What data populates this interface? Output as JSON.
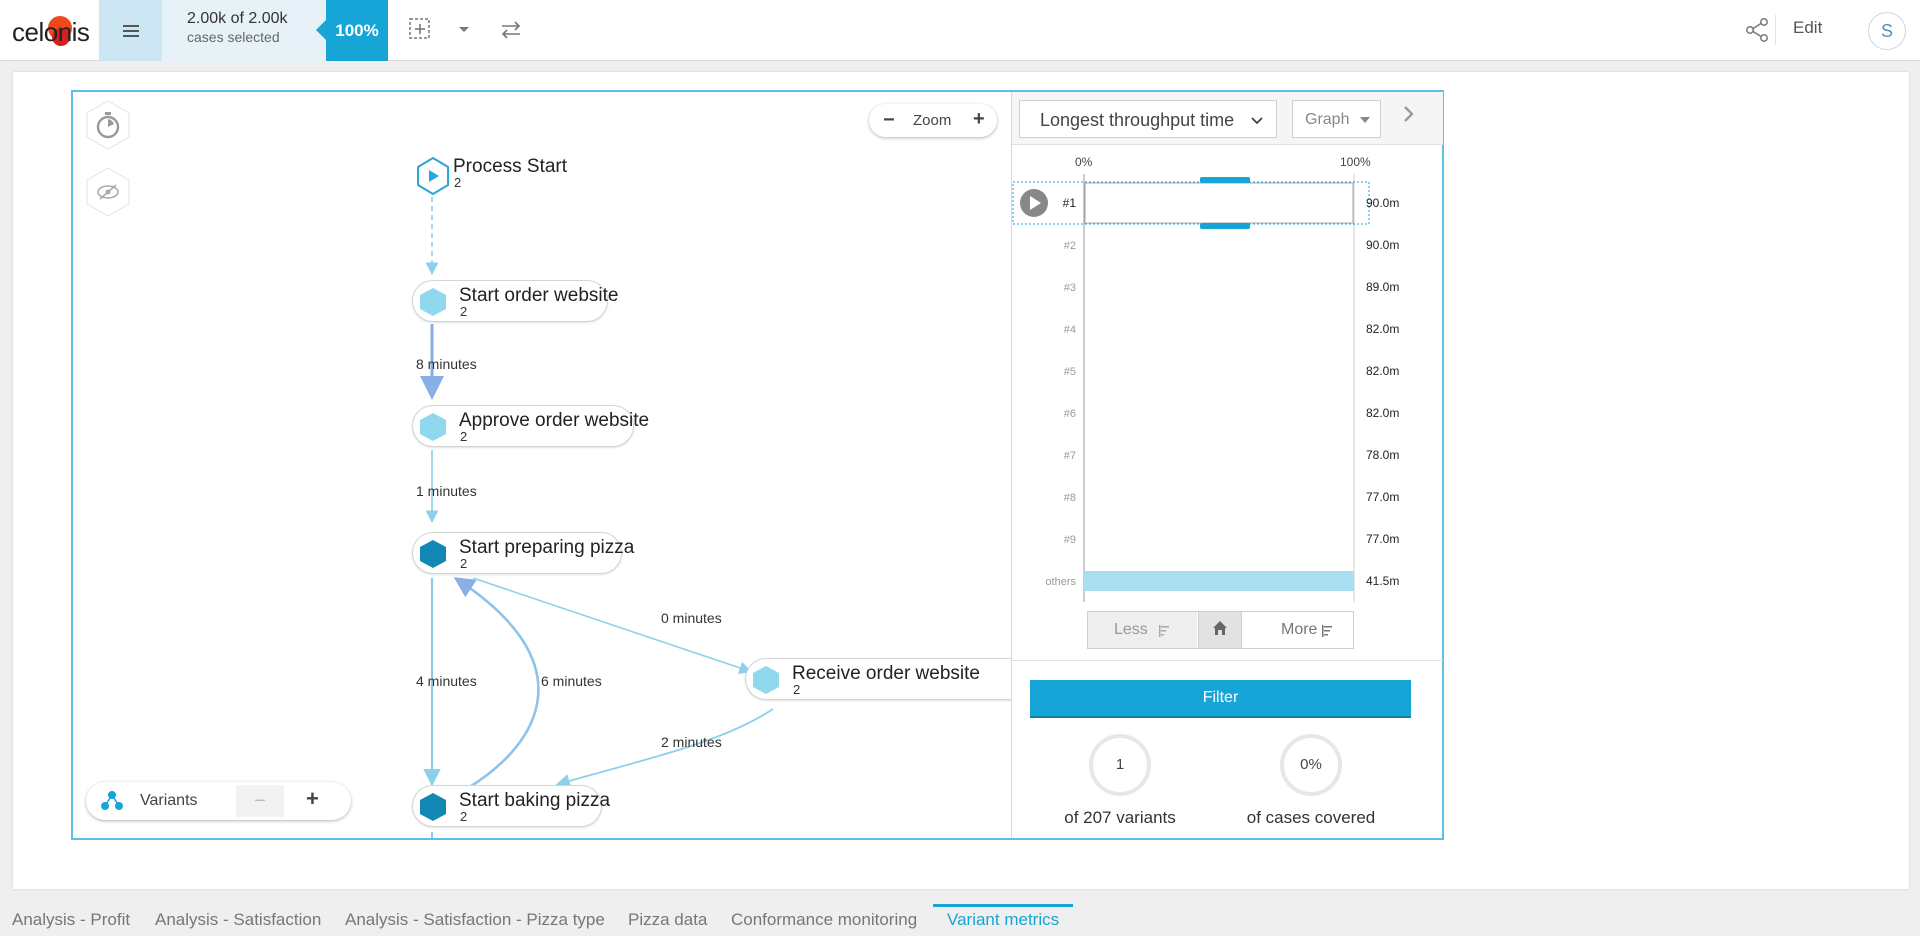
{
  "app": {
    "logo_text": "celonis"
  },
  "topbar": {
    "cases_count": "2.00k of 2.00k",
    "cases_label": "cases selected",
    "cases_pct": "100%",
    "edit_label": "Edit",
    "avatar_initial": "S"
  },
  "canvas": {
    "zoom_label": "Zoom",
    "variants_label": "Variants",
    "zoom_minus": "−",
    "zoom_plus": "+",
    "variants_minus": "−",
    "variants_plus": "+"
  },
  "nodes": [
    {
      "name": "Process Start",
      "count": "2"
    },
    {
      "name": "Start order website",
      "count": "2"
    },
    {
      "name": "Approve order website",
      "count": "2"
    },
    {
      "name": "Start preparing pizza",
      "count": "2"
    },
    {
      "name": "Receive order website",
      "count": "2"
    },
    {
      "name": "Start baking pizza",
      "count": "2"
    }
  ],
  "edges": [
    {
      "label": "8 minutes"
    },
    {
      "label": "1 minutes"
    },
    {
      "label": "0 minutes"
    },
    {
      "label": "4 minutes"
    },
    {
      "label": "6 minutes"
    },
    {
      "label": "2 minutes"
    }
  ],
  "panel": {
    "sort_select": "Longest throughput time",
    "view_select": "Graph",
    "pct_min": "0%",
    "pct_max": "100%",
    "less_label": "Less",
    "more_label": "More",
    "filter_label": "Filter",
    "variants_selected": "1",
    "variants_caption": "of 207 variants",
    "cases_covered": "0%",
    "cases_caption": "of cases covered"
  },
  "chart_data": {
    "type": "bar",
    "categories": [
      "#1",
      "#2",
      "#3",
      "#4",
      "#5",
      "#6",
      "#7",
      "#8",
      "#9",
      "others"
    ],
    "value_labels": [
      "90.0m",
      "90.0m",
      "89.0m",
      "82.0m",
      "82.0m",
      "82.0m",
      "78.0m",
      "77.0m",
      "77.0m",
      "41.5m"
    ],
    "case_share_pct": [
      0,
      0,
      0,
      0,
      0,
      0,
      0,
      0,
      0,
      100
    ],
    "selected": "#1",
    "xlim": [
      0,
      100
    ]
  },
  "colors": {
    "accent": "#17a4d6",
    "light_node": "#8fd8ee",
    "dark_node": "#1188b4",
    "edge": "#8dc9e8"
  },
  "tabs": [
    {
      "label": "Analysis - Profit",
      "active": false
    },
    {
      "label": "Analysis - Satisfaction",
      "active": false
    },
    {
      "label": "Analysis - Satisfaction - Pizza type",
      "active": false
    },
    {
      "label": "Pizza data",
      "active": false
    },
    {
      "label": "Conformance monitoring",
      "active": false
    },
    {
      "label": "Variant metrics",
      "active": true
    }
  ]
}
